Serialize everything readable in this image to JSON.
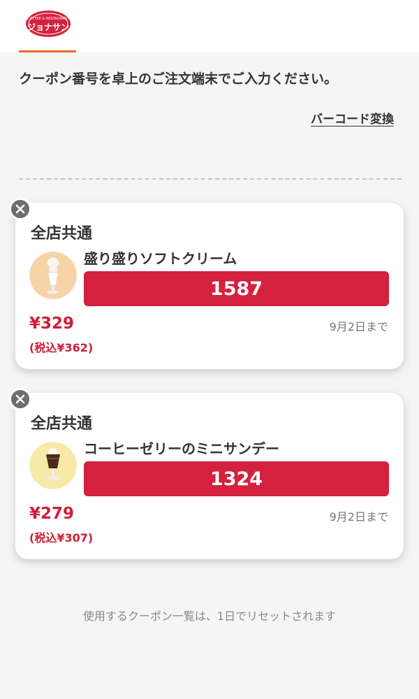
{
  "header": {
    "logo_alt": "COFFEE & RESTAURANT ジョナサン",
    "logo_text_top": "COFFEE & RESTAURANT",
    "logo_text_main": "ジョナサン",
    "brand_color": "#d4213d",
    "active_tab_color": "#e8692a"
  },
  "instruction": "クーポン番号を卓上のご注文端末でご入力ください。",
  "barcode_link": "バーコード変換",
  "coupons": [
    {
      "scope": "全店共通",
      "item_name": "盛り盛りソフトクリーム",
      "code": "1587",
      "price": "¥329",
      "price_tax": "(税込¥362)",
      "expiry": "9月2日まで",
      "thumb_icon": "soft-cream-icon"
    },
    {
      "scope": "全店共通",
      "item_name": "コーヒーゼリーのミニサンデー",
      "code": "1324",
      "price": "¥279",
      "price_tax": "(税込¥307)",
      "expiry": "9月2日まで",
      "thumb_icon": "coffee-jelly-sundae-icon"
    }
  ],
  "footer_note": "使用するクーポン一覧は、1日でリセットされます"
}
